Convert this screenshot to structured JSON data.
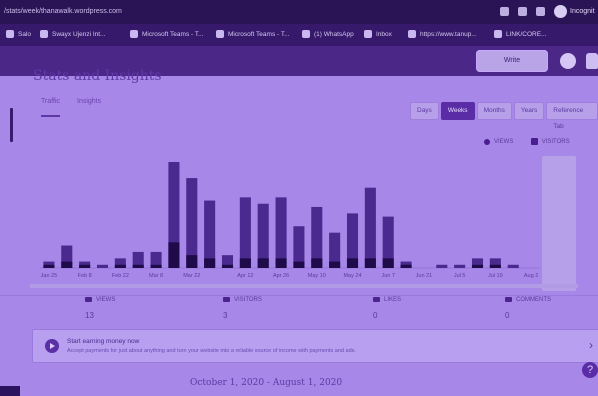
{
  "browser": {
    "url": "/stats/week/thanawalk.wordpress.com",
    "bookmarks": [
      {
        "label": "Salo"
      },
      {
        "label": "Swayx Ujenzi Int..."
      },
      {
        "label": "Microsoft Teams - T..."
      },
      {
        "label": "Microsoft Teams - T..."
      },
      {
        "label": "(1) WhatsApp"
      },
      {
        "label": "Inbox"
      },
      {
        "label": "https://www.tanup..."
      },
      {
        "label": "LINK/CORE..."
      }
    ],
    "profile_label": "Incognit"
  },
  "wp_header": {
    "write_label": "Write"
  },
  "page": {
    "title": "Stats and Insights",
    "tabs": [
      {
        "label": "Traffic",
        "active": true
      },
      {
        "label": "Insights",
        "active": false
      }
    ],
    "period": [
      {
        "label": "Days",
        "active": false
      },
      {
        "label": "Weeks",
        "active": true
      },
      {
        "label": "Months",
        "active": false
      },
      {
        "label": "Years",
        "active": false
      },
      {
        "label": "Reference Tab",
        "active": false
      }
    ],
    "legend": {
      "views": "VIEWS",
      "visitors": "VISITORS"
    },
    "stats": [
      {
        "label": "VIEWS",
        "value": "13"
      },
      {
        "label": "VISITORS",
        "value": "3"
      },
      {
        "label": "LIKES",
        "value": "0"
      },
      {
        "label": "COMMENTS",
        "value": "0"
      }
    ],
    "banner": {
      "title": "Start earning money now",
      "text": "Accept payments for just about anything and turn your website into a reliable source of income with payments and ads."
    },
    "footer": "October 1, 2020 - August 1, 2020"
  },
  "chart_data": {
    "type": "bar",
    "categories": [
      "Jan 25",
      "Feb 1",
      "Feb 8",
      "Feb 15",
      "Feb 22",
      "Mar 1",
      "Mar 8",
      "Mar 15",
      "Mar 22",
      "Mar 29",
      "Apr 5",
      "Apr 12",
      "Apr 19",
      "Apr 26",
      "May 3",
      "May 10",
      "May 17",
      "May 24",
      "May 31",
      "Jun 7",
      "Jun 14",
      "Jun 21",
      "Jun 28",
      "Jul 5",
      "Jul 12",
      "Jul 19",
      "Jul 26",
      "Aug 2"
    ],
    "series": [
      {
        "name": "VIEWS",
        "values": [
          2,
          7,
          2,
          1,
          3,
          5,
          5,
          33,
          28,
          21,
          4,
          22,
          20,
          22,
          13,
          19,
          11,
          17,
          25,
          16,
          2,
          0,
          1,
          1,
          3,
          3,
          1,
          0
        ]
      },
      {
        "name": "VISITORS",
        "values": [
          1,
          2,
          1,
          0,
          1,
          1,
          1,
          8,
          4,
          3,
          1,
          3,
          3,
          3,
          2,
          3,
          2,
          3,
          3,
          3,
          1,
          0,
          0,
          0,
          1,
          1,
          0,
          0
        ]
      }
    ],
    "x_tick_labels": [
      "Jan 25",
      "Feb 8",
      "Feb 22",
      "Mar 8",
      "Mar 22",
      "Apr 12",
      "Apr 26",
      "May 10",
      "May 24",
      "Jun 7",
      "Jun 21",
      "Jul 5",
      "Jul 19",
      "Aug 2"
    ],
    "colors": {
      "views": "#4a2a8f",
      "visitors": "#1f0b4a"
    }
  }
}
